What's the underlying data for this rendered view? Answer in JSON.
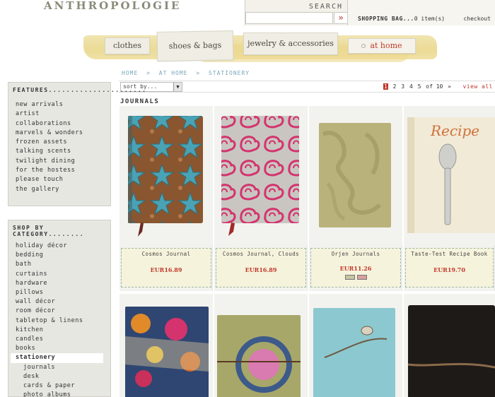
{
  "header": {
    "logo": "ANTHROPOLOGIE",
    "search": {
      "label": "SEARCH",
      "placeholder": "",
      "button": "»"
    },
    "bag": {
      "label": "SHOPPING BAG...",
      "count": "0 item(s)",
      "checkout": "checkout"
    }
  },
  "nav": {
    "tabs": [
      {
        "label": "clothes"
      },
      {
        "label": "shoes & bags"
      },
      {
        "label": "jewelry & accessories"
      },
      {
        "label": "at home",
        "active": true
      }
    ]
  },
  "breadcrumb": [
    "HOME",
    ">",
    "AT HOME",
    ">",
    "STATIONERY"
  ],
  "toolbar": {
    "sort_label": "sort by...",
    "sort_arrow": "▼",
    "pages": [
      "1",
      "2",
      "3",
      "4",
      "5",
      "of 10",
      "»"
    ],
    "current_page": "1",
    "view_all": "view all"
  },
  "sidebar": {
    "features": {
      "title": "FEATURES......................",
      "items": [
        "new arrivals",
        "artist",
        "collaborations",
        "marvels & wonders",
        "frozen assets",
        "talking scents",
        "twilight dining",
        "for the hostess",
        "please touch",
        "the gallery"
      ]
    },
    "categories": {
      "title": "SHOP BY CATEGORY........",
      "items": [
        "holiday décor",
        "bedding",
        "bath",
        "curtains",
        "hardware",
        "pillows",
        "wall décor",
        "room décor",
        "tabletop & linens",
        "kitchen",
        "candles",
        "books",
        "stationery",
        "journals",
        "desk",
        "cards & paper",
        "photo albums"
      ],
      "active": "stationery",
      "subitems": [
        "journals",
        "desk",
        "cards & paper",
        "photo albums"
      ]
    }
  },
  "section_title": "JOURNALS",
  "products": [
    {
      "name": "Cosmos Journal",
      "price": "EUR16.89"
    },
    {
      "name": "Cosmos Journal, Clouds",
      "price": "EUR16.89"
    },
    {
      "name": "Orjen Journals",
      "price": "EUR11.26",
      "swatches": [
        "#c8c4a0",
        "#d9a0a0"
      ]
    },
    {
      "name": "Taste-Test Recipe Book",
      "price": "EUR19.70"
    }
  ],
  "recipe_title": "Recipe",
  "colors": {
    "accent": "#c0392b",
    "sidebar_bg": "#e6e7e1",
    "ribbon": "#e9d78a",
    "breadcrumb": "#7aa7b8"
  }
}
